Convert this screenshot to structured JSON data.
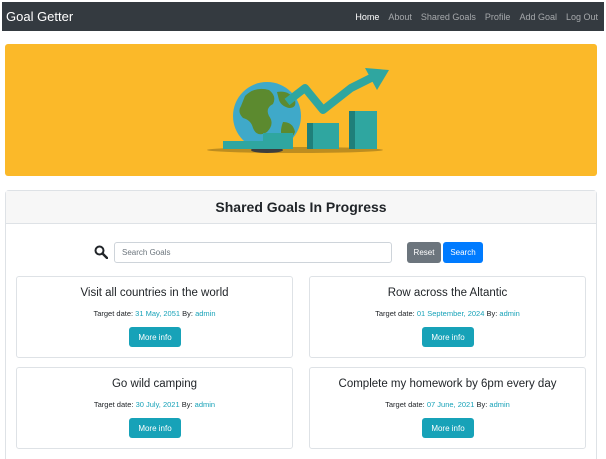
{
  "navbar": {
    "brand": "Goal Getter",
    "links": [
      "Home",
      "About",
      "Shared Goals",
      "Profile",
      "Add Goal",
      "Log Out"
    ],
    "active": "Home"
  },
  "hero": {
    "illustration": "globe-with-rising-chart-arrow",
    "background_color": "#fbb929"
  },
  "panel": {
    "title": "Shared Goals In Progress",
    "search_placeholder": "Search Goals",
    "search_value": "",
    "reset_label": "Reset",
    "search_label": "Search"
  },
  "goals": [
    {
      "title": "Visit all countries in the world",
      "target_label": "Target date:",
      "date": "31 May, 2051",
      "by_label": "By:",
      "author": "admin",
      "button": "More info"
    },
    {
      "title": "Row across the Altantic",
      "target_label": "Target date:",
      "date": "01 September, 2024",
      "by_label": "By:",
      "author": "admin",
      "button": "More info"
    },
    {
      "title": "Go wild camping",
      "target_label": "Target date:",
      "date": "30 July, 2021",
      "by_label": "By:",
      "author": "admin",
      "button": "More info"
    },
    {
      "title": "Complete my homework by 6pm every day",
      "target_label": "Target date:",
      "date": "07 June, 2021",
      "by_label": "By:",
      "author": "admin",
      "button": "More info"
    }
  ],
  "colors": {
    "navbar": "#343a40",
    "primary": "#007bff",
    "secondary": "#6c757d",
    "info": "#17a2b8"
  }
}
